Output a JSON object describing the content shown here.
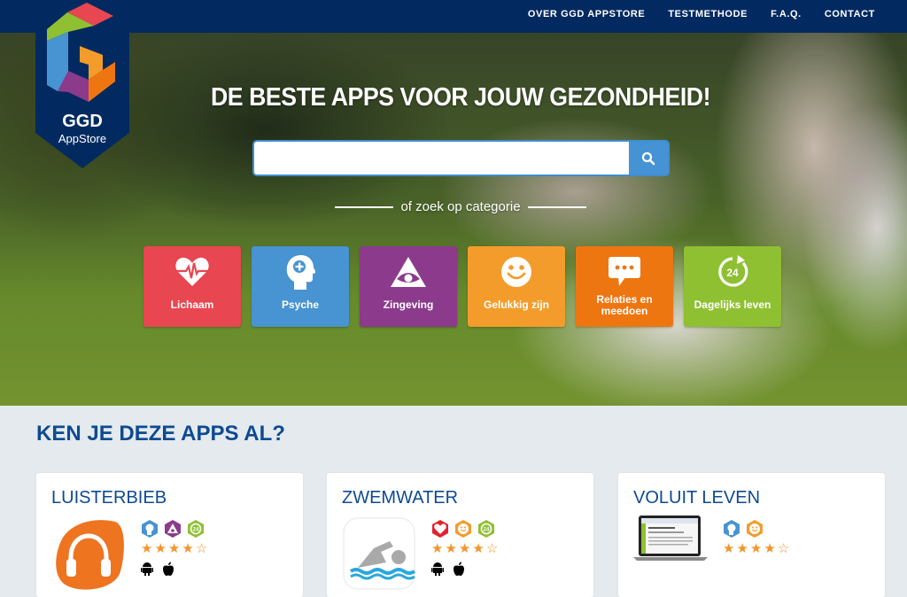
{
  "brand": {
    "name_line1": "GGD",
    "name_line2": "AppStore"
  },
  "nav": {
    "items": [
      {
        "label": "OVER GGD APPSTORE"
      },
      {
        "label": "TESTMETHODE"
      },
      {
        "label": "F.A.Q."
      },
      {
        "label": "CONTACT"
      }
    ]
  },
  "hero": {
    "title": "DE BESTE APPS VOOR JOUW GEZONDHEID!",
    "search": {
      "value": "",
      "placeholder": "",
      "button_icon": "search-icon"
    },
    "category_prompt": "of zoek op categorie",
    "categories": [
      {
        "label": "Lichaam",
        "icon": "heart-pulse-icon",
        "color": "#e84651"
      },
      {
        "label": "Psyche",
        "icon": "head-plus-icon",
        "color": "#4893d1"
      },
      {
        "label": "Zingeving",
        "icon": "eye-triangle-icon",
        "color": "#8b3a8c"
      },
      {
        "label": "Gelukkig zijn",
        "icon": "smiley-icon",
        "color": "#f49c2b"
      },
      {
        "label": "Relaties en meedoen",
        "icon": "speech-bubble-icon",
        "color": "#ee7611"
      },
      {
        "label": "Dagelijks leven",
        "icon": "clock-24-icon",
        "color": "#8fc032"
      }
    ]
  },
  "apps_section": {
    "title": "KEN JE DEZE APPS AL?",
    "apps": [
      {
        "name": "LUISTERBIEB",
        "thumbnail": "headphones-app-icon",
        "categories": [
          "Psyche",
          "Zingeving",
          "Dagelijks leven"
        ],
        "rating": 4,
        "rating_max": 5,
        "platforms": [
          "android",
          "apple"
        ]
      },
      {
        "name": "ZWEMWATER",
        "thumbnail": "swimmer-app-icon",
        "categories": [
          "Lichaam",
          "Gelukkig zijn",
          "Dagelijks leven"
        ],
        "rating": 4,
        "rating_max": 5,
        "platforms": [
          "android",
          "apple"
        ]
      },
      {
        "name": "VOLUIT LEVEN",
        "thumbnail": "laptop-screenshot",
        "categories": [
          "Psyche",
          "Gelukkig zijn"
        ],
        "rating": 4,
        "rating_max": 5,
        "platforms": []
      }
    ]
  },
  "colors": {
    "navy": "#032a60",
    "title_blue": "#0d4a91",
    "search_blue": "#4592d4",
    "star_orange": "#f2952e"
  }
}
